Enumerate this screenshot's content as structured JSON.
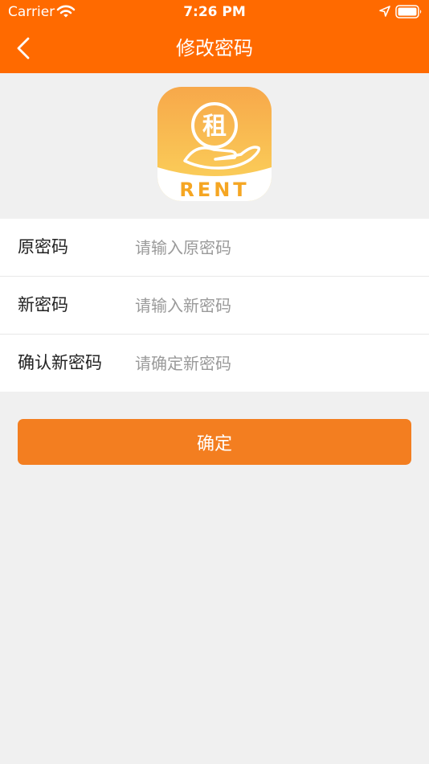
{
  "status_bar": {
    "carrier": "Carrier",
    "time": "7:26 PM",
    "icons": [
      "wifi-icon",
      "location-arrow-icon",
      "battery-icon"
    ]
  },
  "nav": {
    "title": "修改密码",
    "back_icon": "chevron-left-icon"
  },
  "logo": {
    "char": "租",
    "text": "RENT",
    "colors": {
      "gradient_top": "#f7a84a",
      "gradient_bottom": "#fbd55c",
      "band": "#ffffff",
      "text": "#f5a623"
    }
  },
  "form": {
    "fields": [
      {
        "label": "原密码",
        "placeholder": "请输入原密码"
      },
      {
        "label": "新密码",
        "placeholder": "请输入新密码"
      },
      {
        "label": "确认新密码",
        "placeholder": "请确定新密码"
      }
    ]
  },
  "confirm_button": {
    "label": "确定"
  },
  "colors": {
    "header": "#ff6a00",
    "button": "#f37e20",
    "page_background": "#f0f0f0"
  }
}
